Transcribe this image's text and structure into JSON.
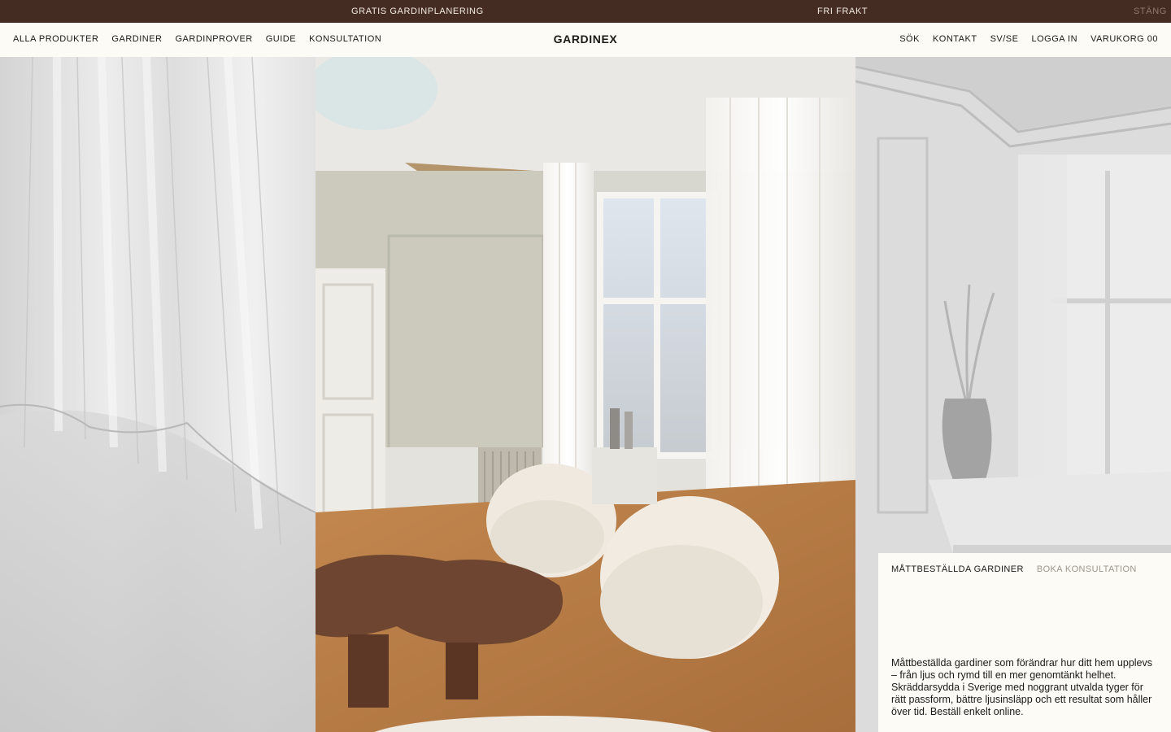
{
  "announcement": {
    "left": "GRATIS GARDINPLANERING",
    "center": "FRI FRAKT",
    "close": "STÄNG"
  },
  "header": {
    "logo": "GARDINEX",
    "nav_left": [
      "ALLA PRODUKTER",
      "GARDINER",
      "GARDINPROVER",
      "GUIDE",
      "KONSULTATION"
    ],
    "nav_right": [
      "SÖK",
      "KONTAKT",
      "SV/SE",
      "LOGGA IN",
      "VARUKORG 00"
    ]
  },
  "card": {
    "tabs": [
      "MÅTTBESTÄLLDA GARDINER",
      "BOKA KONSULTATION"
    ],
    "active_tab": "MÅTTBESTÄLLDA GARDINER",
    "description": "Måttbeställda gardiner som förändrar hur ditt hem upplevs – från ljus och rymd till en mer genomtänkt helhet. Skräddarsydda i Sverige med noggrant utvalda tyger för rätt passform, bättre ljusinsläpp och ett resultat som håller över tid. Beställ enkelt online."
  },
  "colors": {
    "announcement_bg": "#452c22",
    "page_bg": "#fcfbf6",
    "text": "#1c1a17",
    "muted_text": "#9d968c"
  },
  "images": {
    "left": "sheer-curtain-closeup-image",
    "center": "living-room-with-armchairs-image",
    "right": "room-with-curtains-and-vase-image"
  }
}
